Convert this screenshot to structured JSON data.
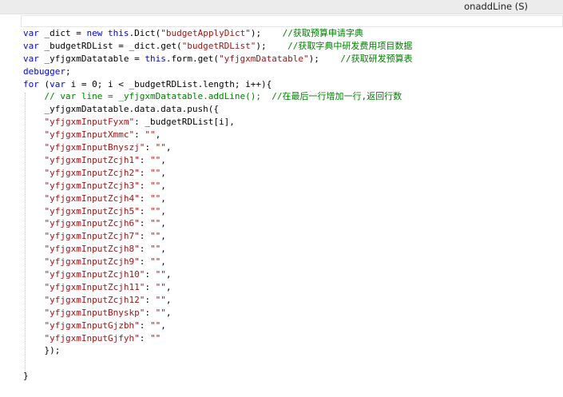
{
  "header": {
    "function_name": "onaddLine (S)"
  },
  "code": [
    "",
    "var _dict = new this.Dict(\"budgetApplyDict\");    //获取预算申请字典",
    "var _budgetRDList = _dict.get(\"budgetRDList\");    //获取字典中研发费用项目数据",
    "var _yfjgxmDatatable = this.form.get(\"yfjgxmDatatable\");    //获取研发预算表",
    "debugger;",
    "for (var i = 0; i < _budgetRDList.length; i++){",
    "    // var line = _yfjgxmDatatable.addLine();  //在最后一行增加一行,返回行数",
    "    _yfjgxmDatatable.data.data.push({",
    "    \"yfjgxmInputFyxm\": _budgetRDList[i],",
    "    \"yfjgxmInputXmmc\": \"\",",
    "    \"yfjgxmInputBnyszj\": \"\",",
    "    \"yfjgxmInputZcjh1\": \"\",",
    "    \"yfjgxmInputZcjh2\": \"\",",
    "    \"yfjgxmInputZcjh3\": \"\",",
    "    \"yfjgxmInputZcjh4\": \"\",",
    "    \"yfjgxmInputZcjh5\": \"\",",
    "    \"yfjgxmInputZcjh6\": \"\",",
    "    \"yfjgxmInputZcjh7\": \"\",",
    "    \"yfjgxmInputZcjh8\": \"\",",
    "    \"yfjgxmInputZcjh9\": \"\",",
    "    \"yfjgxmInputZcjh10\": \"\",",
    "    \"yfjgxmInputZcjh11\": \"\",",
    "    \"yfjgxmInputZcjh12\": \"\",",
    "    \"yfjgxmInputBnyskp\": \"\",",
    "    \"yfjgxmInputGjzbh\": \"\",",
    "    \"yfjgxmInputGjfyh\": \"\"",
    "    });",
    "",
    "}"
  ],
  "gutter_numbers": [
    "",
    "",
    "",
    "",
    "",
    "",
    "",
    "",
    "",
    "",
    "",
    "",
    "",
    "",
    "",
    "",
    "",
    "",
    "",
    "",
    "",
    "",
    "",
    "",
    "",
    "",
    "",
    "",
    "",
    ""
  ],
  "colors": {
    "keyword": "#0000ff",
    "string": "#a31515",
    "comment": "#008000",
    "line_number": "#2b91af",
    "background": "#ffffff"
  }
}
